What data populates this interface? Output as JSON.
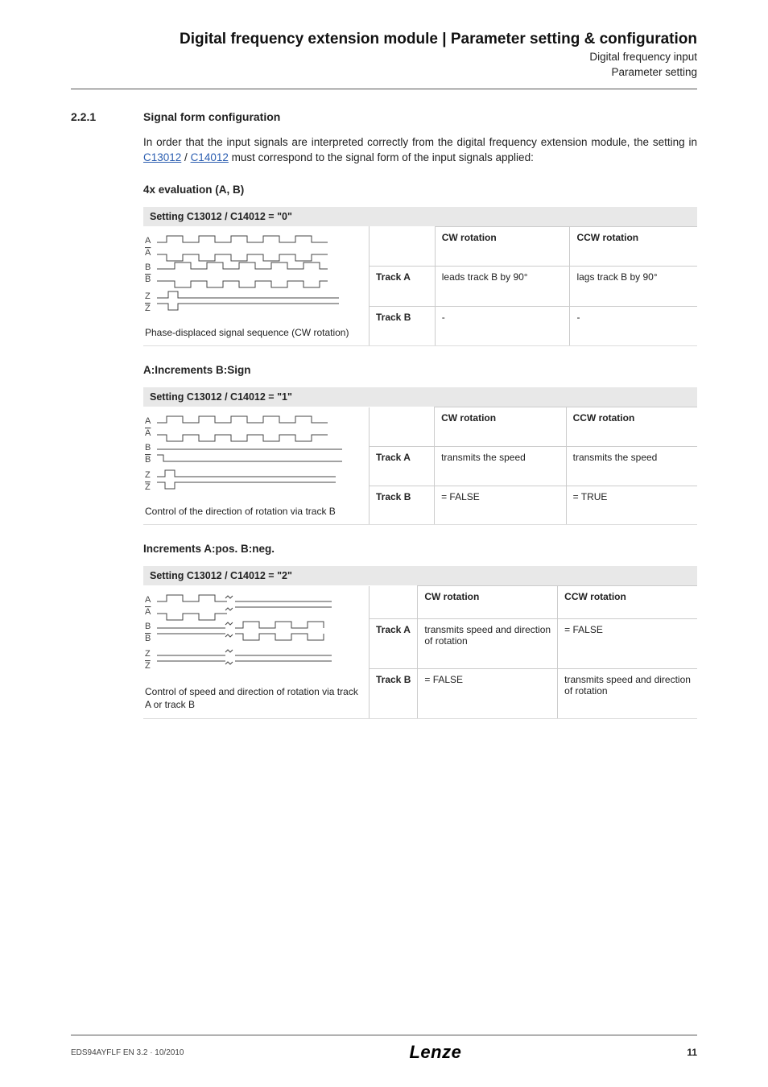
{
  "header": {
    "title": "Digital frequency extension module | Parameter setting & configuration",
    "sub1": "Digital frequency input",
    "sub2": "Parameter setting"
  },
  "section": {
    "num": "2.2.1",
    "title": "Signal form configuration",
    "intro_pre": "In order that the input signals are interpreted correctly from the digital frequency extension module, the setting in ",
    "link1": "C13012",
    "intro_mid": " / ",
    "link2": "C14012",
    "intro_post": " must correspond to the signal form of the input signals applied:"
  },
  "block1": {
    "subhead": "4x evaluation (A, B)",
    "setting": "Setting C13012 / C14012 = \"0\"",
    "caption": "Phase-displaced signal sequence (CW rotation)",
    "cw": "CW rotation",
    "ccw": "CCW rotation",
    "rowA": "Track A",
    "rowB": "Track B",
    "a_cw": "leads track B by 90°",
    "a_ccw": "lags track B by 90°",
    "b_cw": "-",
    "b_ccw": "-"
  },
  "block2": {
    "subhead": "A:Increments B:Sign",
    "setting": "Setting C13012 / C14012 = \"1\"",
    "caption": "Control of the direction of rotation via track B",
    "cw": "CW rotation",
    "ccw": "CCW rotation",
    "rowA": "Track A",
    "rowB": "Track B",
    "a_cw": "transmits the speed",
    "a_ccw": "transmits the speed",
    "b_cw": "= FALSE",
    "b_ccw": "= TRUE"
  },
  "block3": {
    "subhead": "Increments A:pos. B:neg.",
    "setting": "Setting C13012 / C14012 = \"2\"",
    "caption": "Control of speed and direction of rotation via track A or track B",
    "cw": "CW rotation",
    "ccw": "CCW rotation",
    "rowA": "Track A",
    "rowB": "Track B",
    "a_cw": "transmits speed and direction of rotation",
    "a_ccw": "= FALSE",
    "b_cw": "= FALSE",
    "b_ccw": "transmits speed and direction of rotation"
  },
  "footer": {
    "left": "EDS94AYFLF EN 3.2 · 10/2010",
    "logo": "Lenze",
    "page": "11"
  }
}
